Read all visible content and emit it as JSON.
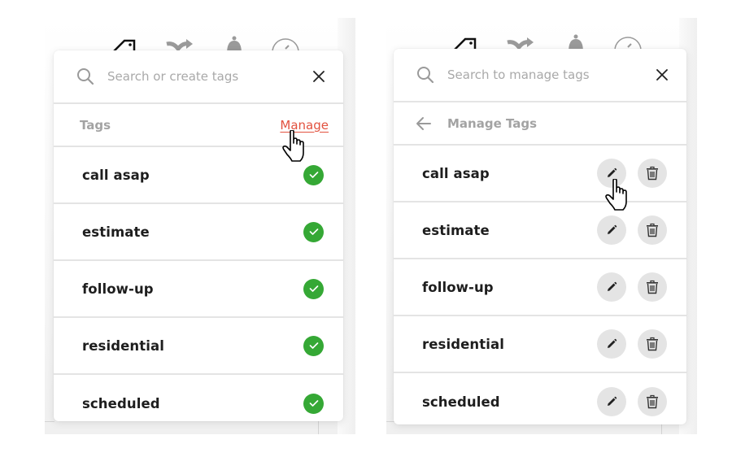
{
  "left_panel": {
    "search": {
      "placeholder": "Search or create tags",
      "value": ""
    },
    "header": {
      "title": "Tags",
      "manage_label": "Manage"
    },
    "tags": [
      {
        "label": "call asap",
        "selected": true
      },
      {
        "label": "estimate",
        "selected": true
      },
      {
        "label": "follow-up",
        "selected": true
      },
      {
        "label": "residential",
        "selected": true
      },
      {
        "label": "scheduled",
        "selected": true
      }
    ]
  },
  "right_panel": {
    "search": {
      "placeholder": "Search to manage tags",
      "value": ""
    },
    "header": {
      "title": "Manage Tags"
    },
    "tags": [
      {
        "label": "call asap"
      },
      {
        "label": "estimate"
      },
      {
        "label": "follow-up"
      },
      {
        "label": "residential"
      },
      {
        "label": "scheduled"
      }
    ]
  },
  "toolbar_icons": [
    "tag-icon",
    "merge-icon",
    "bell-icon",
    "clock-icon"
  ],
  "colors": {
    "accent_link": "#e2523f",
    "check_green": "#35a835",
    "action_button_bg": "#e4e4e4",
    "muted_text": "#a3a3a3"
  }
}
